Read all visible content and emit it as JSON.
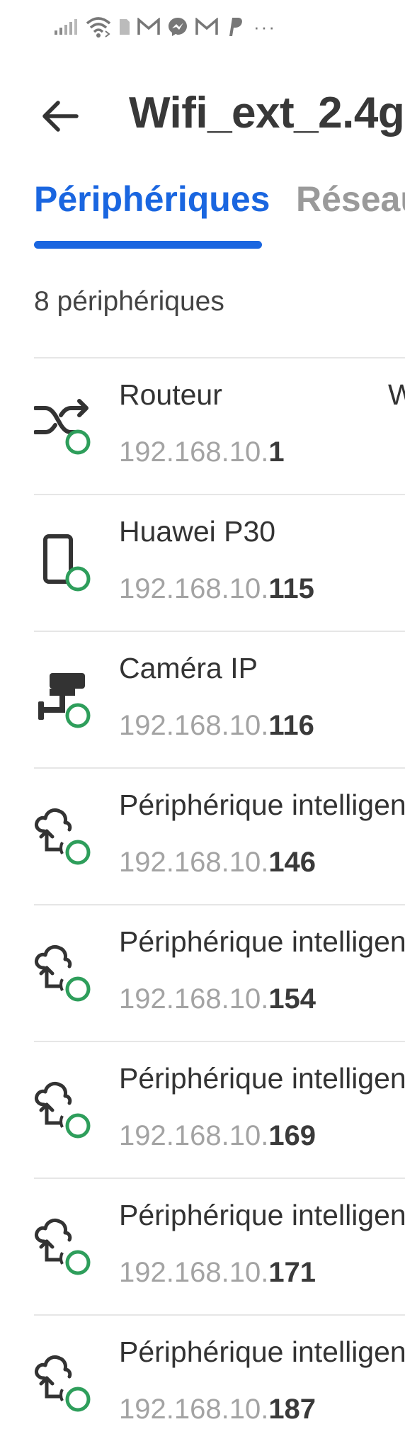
{
  "status_bar": {
    "icons": [
      "signal-icon",
      "wifi-icon",
      "sim-icon",
      "gmail-icon",
      "messenger-icon",
      "gmail-icon",
      "paypal-icon"
    ],
    "more": "···"
  },
  "header": {
    "title": "Wifi_ext_2.4g",
    "back_icon": "arrow-left-icon"
  },
  "tabs": [
    {
      "label": "Périphériques",
      "active": true
    },
    {
      "label": "Réseau",
      "active": false
    }
  ],
  "colors": {
    "accent": "#1a66e0",
    "online": "#2e9e5b",
    "icon": "#333333"
  },
  "device_count": "8 périphériques",
  "devices": [
    {
      "name": "Routeur",
      "ip_prefix": "192.168.10.",
      "ip_suffix": "1",
      "icon": "router-shuffle-icon",
      "extra": "W"
    },
    {
      "name": "Huawei P30",
      "ip_prefix": "192.168.10.",
      "ip_suffix": "115",
      "icon": "smartphone-icon"
    },
    {
      "name": "Caméra IP",
      "ip_prefix": "192.168.10.",
      "ip_suffix": "116",
      "icon": "security-camera-icon"
    },
    {
      "name": "Périphérique intelligent",
      "ip_prefix": "192.168.10.",
      "ip_suffix": "146",
      "icon": "smart-device-icon"
    },
    {
      "name": "Périphérique intelligent",
      "ip_prefix": "192.168.10.",
      "ip_suffix": "154",
      "icon": "smart-device-icon"
    },
    {
      "name": "Périphérique intelligent",
      "ip_prefix": "192.168.10.",
      "ip_suffix": "169",
      "icon": "smart-device-icon"
    },
    {
      "name": "Périphérique intelligent",
      "ip_prefix": "192.168.10.",
      "ip_suffix": "171",
      "icon": "smart-device-icon"
    },
    {
      "name": "Périphérique intelligent",
      "ip_prefix": "192.168.10.",
      "ip_suffix": "187",
      "icon": "smart-device-icon"
    }
  ]
}
